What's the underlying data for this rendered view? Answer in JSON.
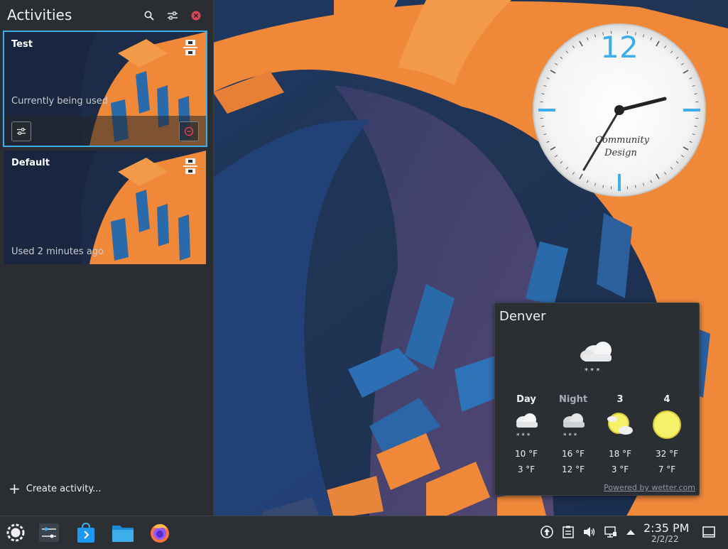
{
  "activities": {
    "title": "Activities",
    "create_label": "Create activity...",
    "items": [
      {
        "name": "Test",
        "status": "Currently being used",
        "selected": true
      },
      {
        "name": "Default",
        "status": "Used 2 minutes ago",
        "selected": false
      }
    ]
  },
  "clock": {
    "number_12": "12",
    "brand_line1": "Community",
    "brand_line2": "Design"
  },
  "weather": {
    "city": "Denver",
    "current_icon": "snow-icon",
    "forecast": [
      {
        "label": "Day",
        "icon": "snow-icon",
        "high": "10 °F",
        "low": "3 °F"
      },
      {
        "label": "Night",
        "icon": "snow-icon",
        "high": "16 °F",
        "low": "12 °F"
      },
      {
        "label": "3",
        "icon": "partly-cloudy-icon",
        "high": "18 °F",
        "low": "3 °F"
      },
      {
        "label": "4",
        "icon": "sun-icon",
        "high": "32 °F",
        "low": "7 °F"
      }
    ],
    "credit": "Powered by wetter.com"
  },
  "taskbar": {
    "time": "2:35 PM",
    "date": "2/2/22"
  },
  "colors": {
    "accent": "#3daee9",
    "wallpaper_orange": "#f0883a",
    "wallpaper_blue": "#2b5f9e",
    "panel": "#2a2e32"
  }
}
